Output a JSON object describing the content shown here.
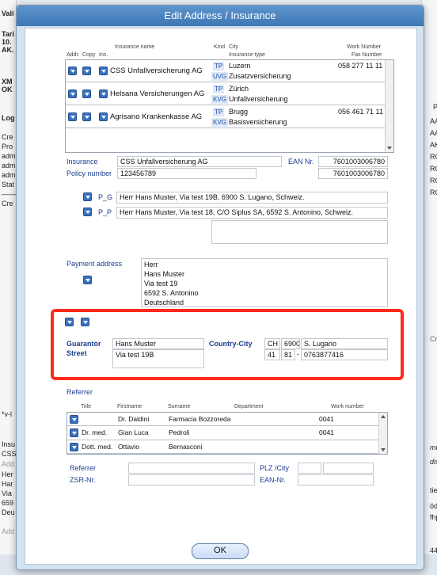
{
  "background": {
    "left_texts": [
      "Vali",
      "Tari",
      "10.",
      "AK.",
      "XM",
      "OK",
      "Log",
      "Cre",
      "Pro",
      "adm",
      "adm",
      "adm",
      "Stat",
      "——",
      "Cre",
      "*v-l",
      "Insu",
      "CSS",
      "Add",
      "Her",
      "Har",
      "Via",
      "659",
      "Deu",
      "Add"
    ],
    "right_texts": [
      "Pe",
      "AA",
      "AA",
      "AK",
      "RO",
      "RO",
      "RO",
      "RO",
      "Cre",
      "mitt",
      "distu",
      "tie c",
      "ödf",
      "fhpj",
      "44"
    ]
  },
  "dialog": {
    "title": "Edit Address / Insurance",
    "ok_label": "OK"
  },
  "insurance_table": {
    "headers": {
      "addr": "Addr.",
      "copy": "Copy",
      "ins": "Ins.",
      "insurance_name": "Insurance name",
      "kind": "Kind",
      "city": "City",
      "insurance_type": "Insurance type",
      "work_number": "Work Number",
      "fax_number": "Fax Number"
    },
    "rows": [
      {
        "name": "CSS Unfallversicherung AG",
        "kind1": "TP",
        "city": "Luzern",
        "kind2": "UVG",
        "type": "Zusatzversicherung",
        "work": "058 277 11 11"
      },
      {
        "name": "Helsana Versicherungen AG",
        "kind1": "TP",
        "city": "Zürich",
        "kind2": "KVG",
        "type": "Unfallversicherung",
        "work": ""
      },
      {
        "name": "Agrisano Krankenkasse AG",
        "kind1": "TP",
        "city": "Brugg",
        "kind2": "KVG",
        "type": "Basisversicherung",
        "work": "056 461 71 11"
      }
    ]
  },
  "insurance_detail": {
    "insurance_label": "Insurance",
    "insurance_value": "CSS Unfallversicherung AG",
    "ean_label": "EAN Nr.",
    "ean_value": "7601003006780",
    "policy_label": "Policy number",
    "policy_value": "123456789",
    "ean_value2": "7601003006780",
    "pg_label": "P_G",
    "pg_value": "Herr Hans Muster, Via test 19B, 6900 S. Lugano, Schweiz.",
    "pp_label": "P_P",
    "pp_value": "Herr Hans Muster, Via test 18, C/O Siplus SA, 6592 S. Antonino, Schweiz."
  },
  "payment": {
    "label": "Payment address",
    "lines": [
      "Herr",
      "Hans Muster",
      "Via test 19",
      "6592 S. Antonino",
      "Deutschland"
    ]
  },
  "guarantor": {
    "guarantor_label": "Guarantor",
    "guarantor_value": "Hans Muster",
    "street_label": "Street",
    "street_value": "Via test 19B",
    "country_city_label": "Country-City",
    "country": "CH",
    "zip": "6900",
    "city": "S. Lugano",
    "phone_prefix": "41",
    "phone_area": "81",
    "phone_number": "0763877416",
    "sep1": "-",
    "sep2": "-"
  },
  "referrer_table": {
    "title": "Referrer",
    "headers": {
      "title": "Title",
      "firstname": "Firstname",
      "surname": "Surname",
      "department": "Department",
      "work_number": "Work number"
    },
    "rows": [
      {
        "title": "",
        "firstname": "Dr. Daldini",
        "surname": "Farmacia Bozzoreda",
        "department": "",
        "work": "0041"
      },
      {
        "title": "Dr. med.",
        "firstname": "Gian Luca",
        "surname": "Pedroli",
        "department": "",
        "work": "0041"
      },
      {
        "title": "Dott. med.",
        "firstname": "Ottavio",
        "surname": "Bernasconi",
        "department": "",
        "work": ""
      }
    ]
  },
  "referrer_form": {
    "referrer_label": "Referrer",
    "zsr_label": "ZSR-Nr.",
    "plz_label": "PLZ /City",
    "ean_label": "EAN-Nr."
  },
  "colors": {
    "title_bar": "#4a84c2",
    "accent": "#3a72c0",
    "highlight": "#ff2a1a"
  }
}
